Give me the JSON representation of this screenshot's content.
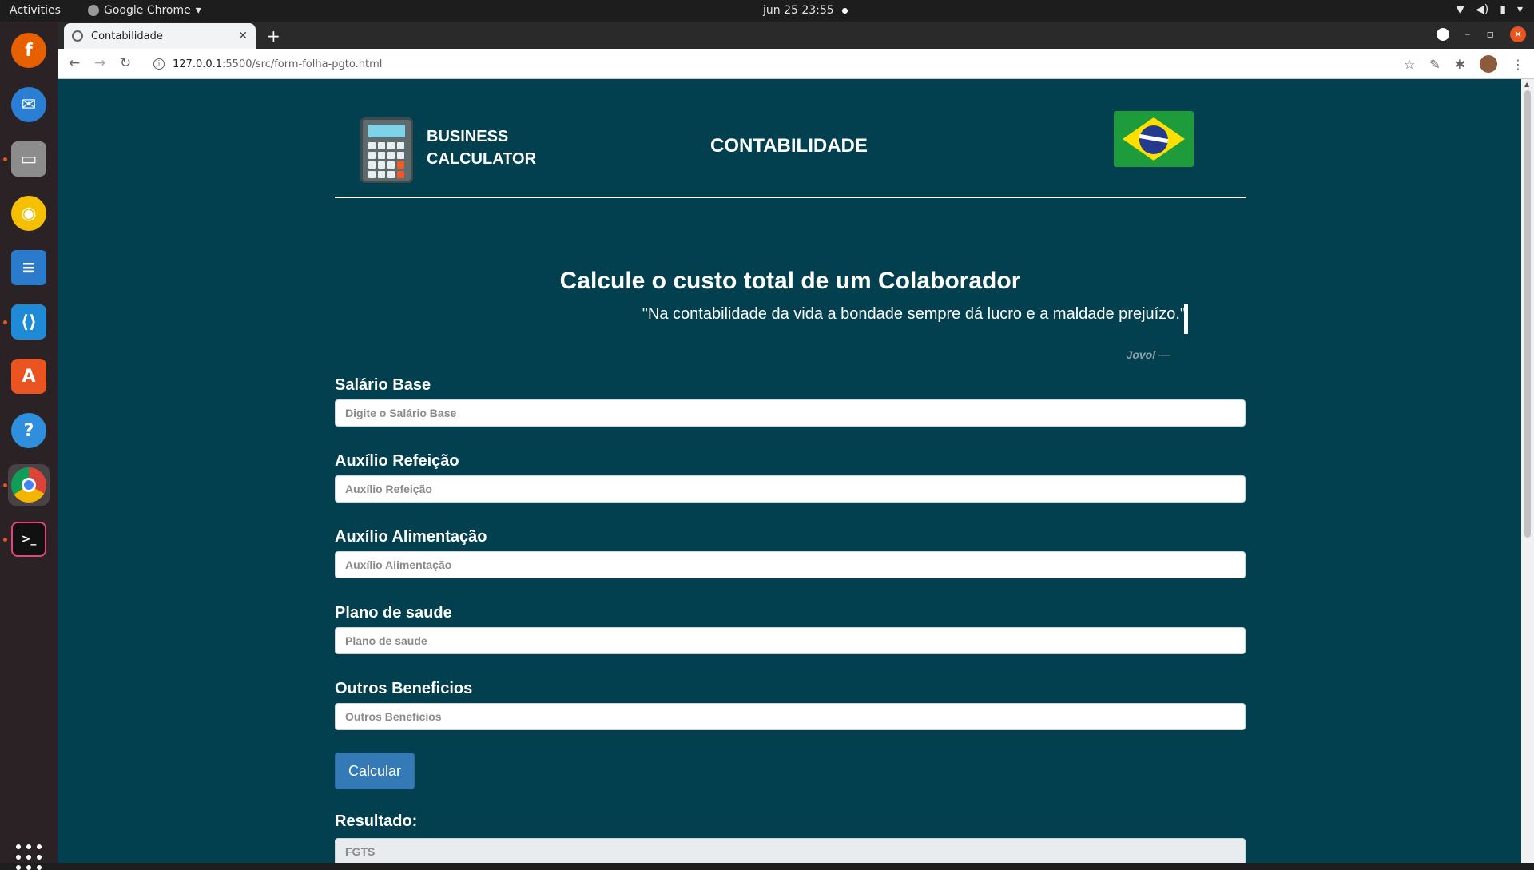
{
  "system": {
    "activities": "Activities",
    "app_menu": "Google Chrome",
    "clock": "jun 25  23:55"
  },
  "browser": {
    "tab_title": "Contabilidade",
    "url_host": "127.0.0.1",
    "url_path": ":5500/src/form-folha-pgto.html"
  },
  "page": {
    "brand_line1": "BUSINESS",
    "brand_line2": "CALCULATOR",
    "section_title": "CONTABILIDADE",
    "heading": "Calcule o custo total de um Colaborador",
    "quote": "\"Na contabilidade da vida a bondade sempre dá lucro e a maldade prejuízo.\"",
    "quote_author": "Jovol —",
    "fields": [
      {
        "label": "Salário Base",
        "placeholder": "Digite o Salário Base",
        "value": ""
      },
      {
        "label": "Auxílio Refeição",
        "placeholder": "Auxílio Refeição",
        "value": ""
      },
      {
        "label": "Auxílio Alimentação",
        "placeholder": "Auxílio Alimentação",
        "value": ""
      },
      {
        "label": "Plano de saude",
        "placeholder": "Plano de saude",
        "value": ""
      },
      {
        "label": "Outros Beneficios",
        "placeholder": "Outros Beneficios",
        "value": ""
      }
    ],
    "button_label": "Calcular",
    "result_label": "Resultado:",
    "result_field_placeholder": "FGTS"
  },
  "colors": {
    "page_background": "#02404f",
    "button": "#337ab7"
  }
}
